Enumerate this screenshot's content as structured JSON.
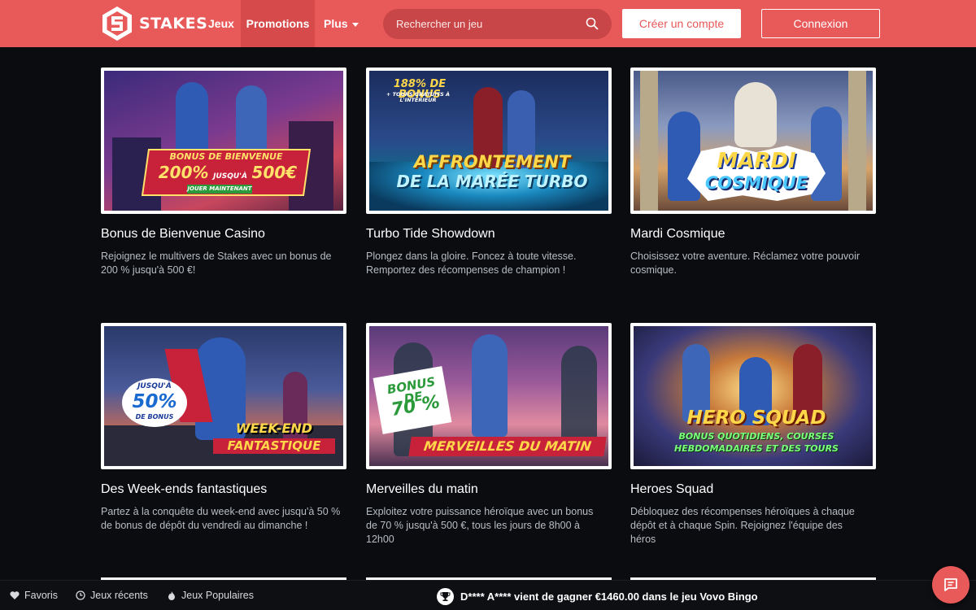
{
  "brand": {
    "name": "STAKES",
    "color": "#e8595a"
  },
  "nav": {
    "jeux": "Jeux",
    "promotions": "Promotions",
    "plus": "Plus"
  },
  "search": {
    "placeholder": "Rechercher un jeu",
    "icon": "search-icon"
  },
  "auth": {
    "create": "Créer un compte",
    "login": "Connexion"
  },
  "promos": [
    {
      "title": "Bonus de Bienvenue Casino",
      "desc": "Rejoignez le multivers de Stakes avec un bonus de 200 % jusqu'à 500 €!",
      "art": {
        "l1": "BONUS DE BIENVENUE",
        "l2": "200%",
        "l3": "JUSQU'À",
        "l4": "500€",
        "l5": "JOUER MAINTENANT"
      }
    },
    {
      "title": "Turbo Tide Showdown",
      "desc": "Plongez dans la gloire. Foncez à toute vitesse. Remportez des récompenses de champion !",
      "art": {
        "l1": "188% DE BONUS",
        "l2": "+ TOURS GRATUITS À L'INTÉRIEUR",
        "l3": "AFFRONTEMENT",
        "l4": "DE LA MARÉE TURBO"
      }
    },
    {
      "title": "Mardi Cosmique",
      "desc": "Choisissez votre aventure. Réclamez votre pouvoir cosmique.",
      "art": {
        "l1": "MARDI",
        "l2": "COSMIQUE"
      }
    },
    {
      "title": "Des Week-ends fantastiques",
      "desc": "Partez à la conquête du week-end avec jusqu'à 50 % de bonus de dépôt du vendredi au dimanche !",
      "art": {
        "l1": "JUSQU'À",
        "l2": "50%",
        "l3": "DE BONUS",
        "l4": "WEEK-END",
        "l5": "FANTASTIQUE"
      }
    },
    {
      "title": "Merveilles du matin",
      "desc": "Exploitez votre puissance héroïque avec un bonus de 70 % jusqu'à 500 €, tous les jours de 8h00 à 12h00",
      "art": {
        "l1": "BONUS DE",
        "l2": "70 %",
        "l3": "MERVEILLES DU MATIN"
      }
    },
    {
      "title": "Heroes Squad",
      "desc": "Débloquez des récompenses héroïques à chaque dépôt et à chaque Spin. Rejoignez l'équipe des héros",
      "art": {
        "l1": "HERO SQUAD",
        "l2": "BONUS QUOTIDIENS, COURSES",
        "l3": "HEBDOMADAIRES ET DES TOURS"
      }
    }
  ],
  "footer": {
    "favoris": "Favoris",
    "recents": "Jeux récents",
    "populaires": "Jeux Populaires",
    "winner_user": "D**** A****",
    "winner_text": "vient de gagner €1460.00 dans le jeu Vovo Bingo"
  }
}
